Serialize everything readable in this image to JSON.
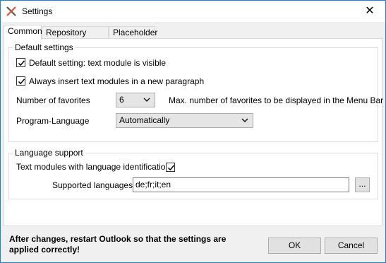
{
  "window": {
    "title": "Settings",
    "close_glyph": "✕"
  },
  "tabs": [
    {
      "label": "Common",
      "active": true
    },
    {
      "label": "Repository folders",
      "active": false
    },
    {
      "label": "Placeholder",
      "active": false
    }
  ],
  "default_settings": {
    "group_label": "Default settings",
    "text_module_visible": {
      "label": "Default setting: text module is visible",
      "checked": true
    },
    "insert_new_paragraph": {
      "label": "Always insert text modules in a new paragraph",
      "checked": true
    },
    "favorites": {
      "label": "Number of favorites",
      "value": "6",
      "hint": "Max. number of favorites to be displayed in the Menu Bar"
    },
    "program_language": {
      "label": "Program-Language",
      "value": "Automatically"
    }
  },
  "language_support": {
    "group_label": "Language support",
    "identification": {
      "label": "Text modules with language identification",
      "checked": true
    },
    "supported": {
      "label": "Supported languages",
      "value": "de;fr;it;en",
      "browse_label": "..."
    }
  },
  "footer": {
    "message": "After changes, restart Outlook so that the settings are applied correctly!",
    "ok_label": "OK",
    "cancel_label": "Cancel"
  }
}
